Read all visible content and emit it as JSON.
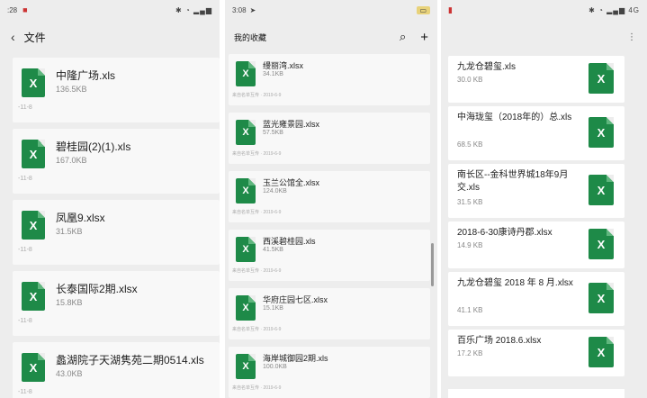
{
  "colors": {
    "excel_green": "#1e8a48",
    "panel_bg": "#ededed"
  },
  "panel1": {
    "status_time": ":28",
    "title": "文件",
    "back_icon": "chevron-left-icon",
    "files": [
      {
        "name": "中隆广场.xls",
        "size": "136.5KB",
        "meta": "-11-8"
      },
      {
        "name": "碧桂园(2)(1).xls",
        "size": "167.0KB",
        "meta": "-11-8"
      },
      {
        "name": "凤凰9.xlsx",
        "size": "31.5KB",
        "meta": "-11-8"
      },
      {
        "name": "长泰国际2期.xlsx",
        "size": "15.8KB",
        "meta": "-11-8"
      },
      {
        "name": "蠡湖院子天湖隽苑二期0514.xls",
        "size": "43.0KB",
        "meta": "-11-8"
      }
    ]
  },
  "panel2": {
    "status_time": "3:08",
    "title": "我的收藏",
    "search_icon": "search-icon",
    "add_icon": "plus-icon",
    "files": [
      {
        "name": "缦丽湾.xlsx",
        "size": "34.1KB",
        "meta": "来自名单互传 · 2019-6-9"
      },
      {
        "name": "蓝光雍景园.xlsx",
        "size": "57.5KB",
        "meta": "来自名单互传 · 2019-6-9"
      },
      {
        "name": "玉兰公馆全.xlsx",
        "size": "124.0KB",
        "meta": "来自名单互传 · 2019-6-9"
      },
      {
        "name": "西溪碧桂园.xls",
        "size": "41.5KB",
        "meta": "来自名单互传 · 2019-6-9"
      },
      {
        "name": "华府庄园七区.xlsx",
        "size": "15.1KB",
        "meta": "来自名单互传 · 2019-6-9"
      },
      {
        "name": "海岸城御园2期.xls",
        "size": "100.0KB",
        "meta": "来自名单互传 · 2019-6-9"
      }
    ]
  },
  "panel3": {
    "status_right": "4G",
    "files": [
      {
        "name": "九龙仓碧玺.xls",
        "size": "30.0 KB"
      },
      {
        "name": "中海珑玺（2018年的）总.xls",
        "size": "68.5 KB"
      },
      {
        "name": "南长区--金科世界城18年9月交.xls",
        "size": "31.5 KB"
      },
      {
        "name": "2018-6-30康诗丹郡.xlsx",
        "size": "14.9 KB"
      },
      {
        "name": "九龙仓碧玺 2018 年 8 月.xlsx",
        "size": "41.1 KB"
      },
      {
        "name": "百乐广场 2018.6.xlsx",
        "size": "17.2 KB"
      }
    ]
  }
}
